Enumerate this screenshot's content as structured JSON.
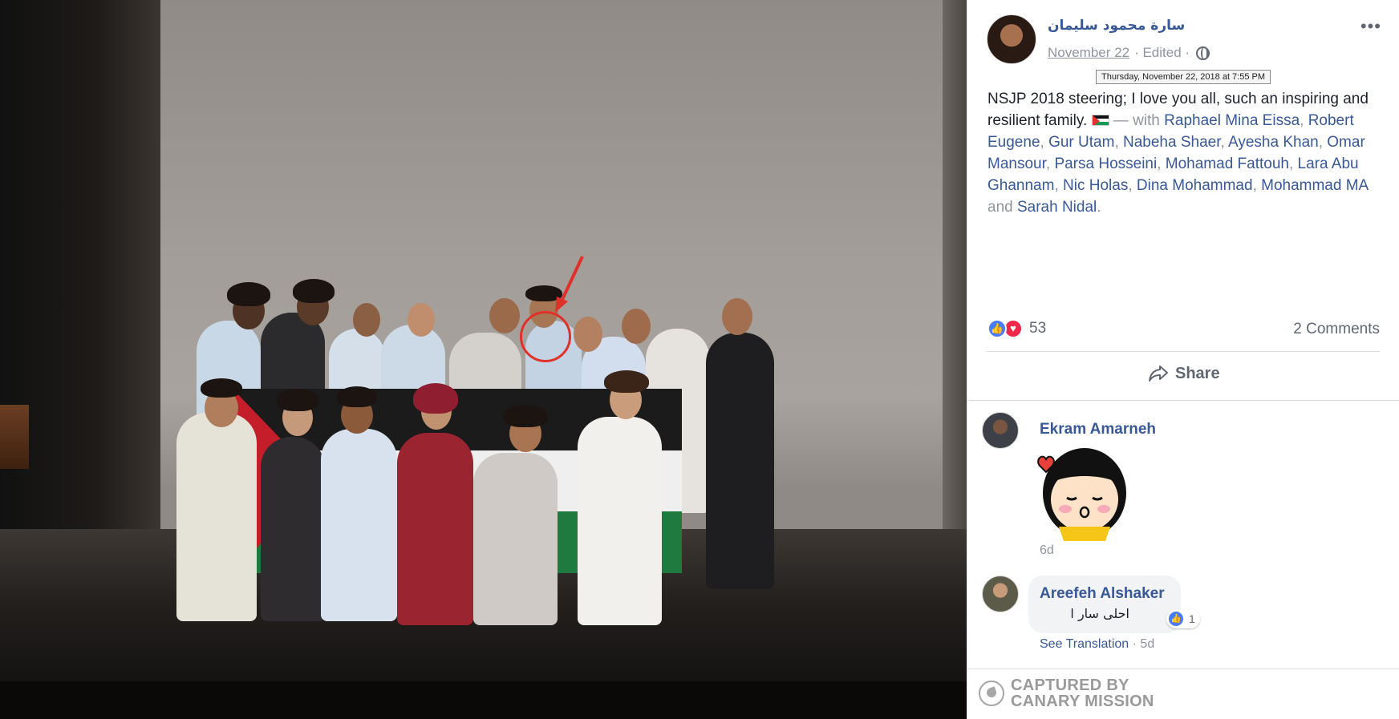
{
  "post": {
    "author": "سارة محمود سليمان",
    "date": "November 22",
    "edited": "· Edited ·",
    "date_tooltip": "Thursday, November 22, 2018 at 7:55 PM",
    "text_1": "NSJP 2018 steering; I love you all, such an inspiring and resilient family.",
    "with_label": "— with",
    "tags": [
      "Raphael Mina Eissa",
      "Robert Eugene",
      "Gur Utam",
      "Nabeha Shaer",
      "Ayesha Khan",
      "Omar Mansour",
      "Parsa Hosseini",
      "Mohamad Fattouh",
      "Lara Abu Ghannam",
      "Nic Holas",
      "Dina Mohammad",
      "Mohammad MA",
      "Sarah Nidal"
    ],
    "and_label": "and",
    "period": ".",
    "more_icon": "•••"
  },
  "reactions": {
    "count": "53",
    "comments": "2 Comments",
    "like_glyph": "👍",
    "love_glyph": "♥"
  },
  "actions": {
    "share": "Share"
  },
  "comments": [
    {
      "name": "Ekram Amarneh",
      "time": "6d"
    },
    {
      "name": "Areefeh Alshaker",
      "text": "احلى سار ا",
      "reaction_count": "1",
      "see_translation": "See Translation",
      "time": "· 5d"
    }
  ],
  "watermark": {
    "line1": "CAPTURED BY",
    "line2": "CANARY MISSION"
  },
  "colors": {
    "link": "#385898",
    "muted": "#90949c",
    "like": "#4a7bff",
    "love": "#f0284a",
    "annotation": "#e0302a"
  }
}
